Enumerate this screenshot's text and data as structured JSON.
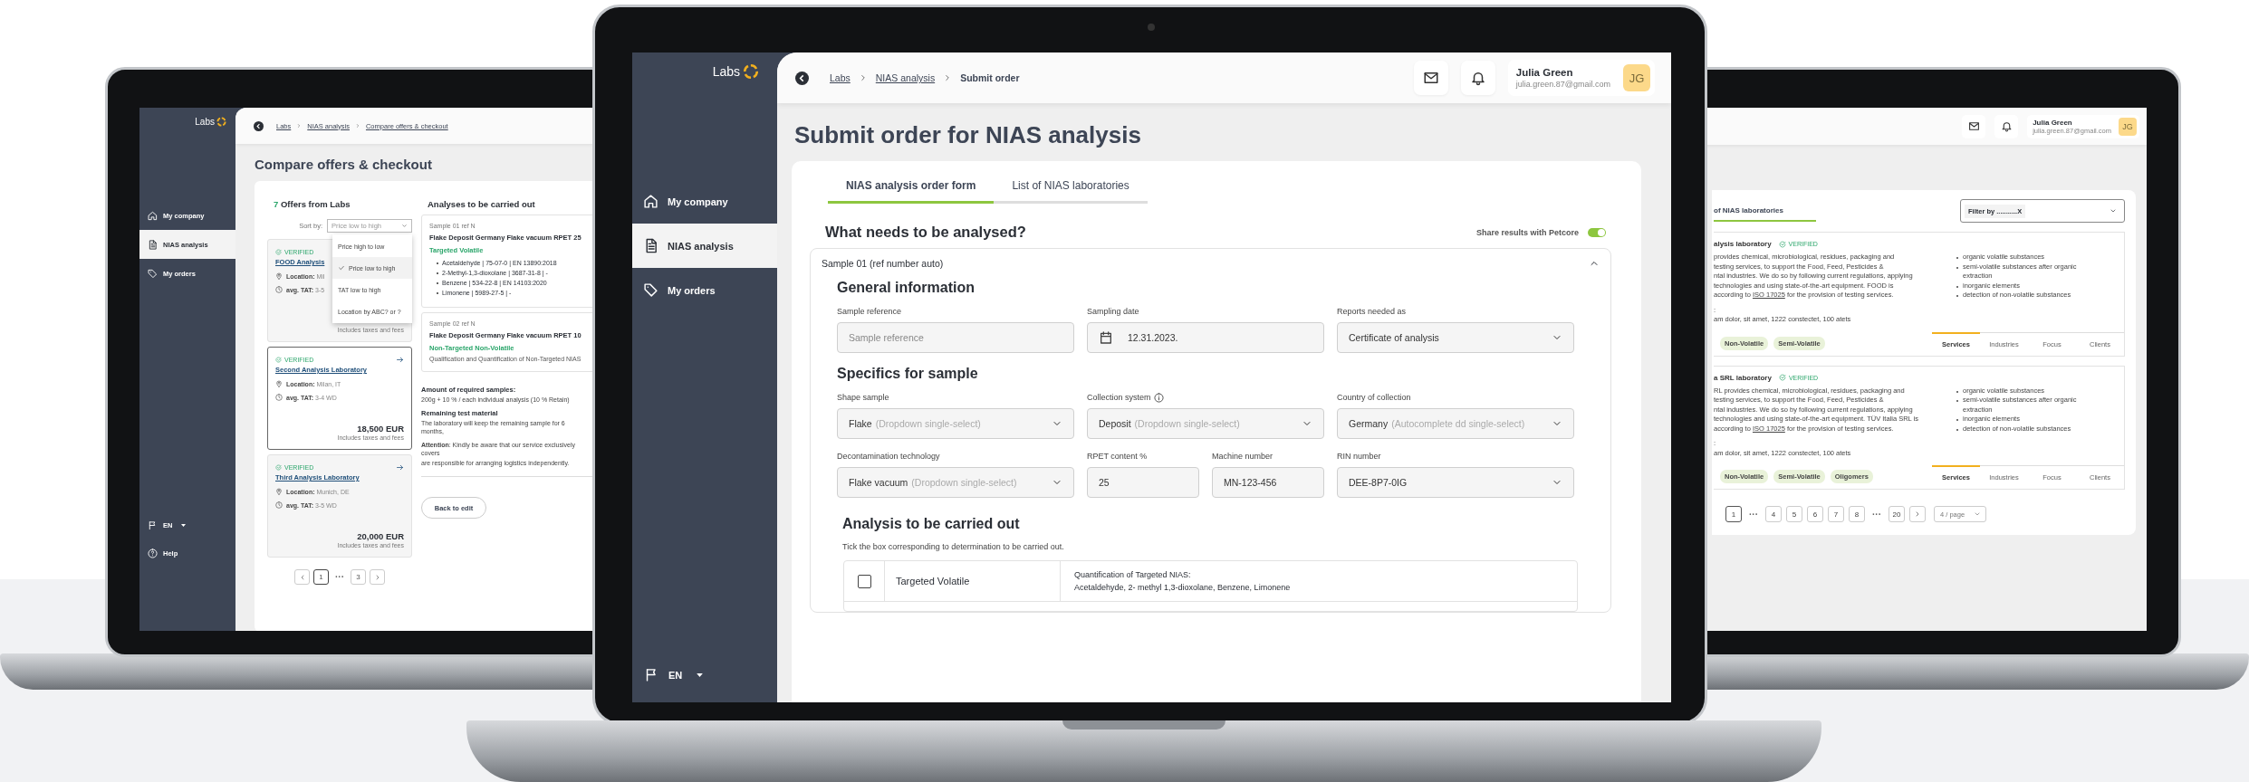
{
  "left_screen": {
    "sidebar": {
      "logo": "Labs",
      "items": [
        {
          "kind": "home",
          "label": "My company",
          "selected": false
        },
        {
          "kind": "document",
          "label": "NIAS analysis",
          "selected": true
        },
        {
          "kind": "tag",
          "label": "My orders",
          "selected": false
        }
      ],
      "language": "EN",
      "help": "Help"
    },
    "breadcrumb": [
      {
        "label": "Labs"
      },
      {
        "label": "NIAS analysis"
      },
      {
        "label": "Compare offers & checkout"
      }
    ],
    "title": "Compare offers & checkout",
    "offers": {
      "count": "7",
      "label": "Offers from Labs",
      "sort_label": "Sort by:",
      "sort_value": "Price low to high",
      "sort_open": true,
      "sort_options": [
        {
          "label": "Price high to low",
          "selected": false
        },
        {
          "label": "Price low to high",
          "selected": true
        },
        {
          "label": "TAT low to high",
          "selected": false
        },
        {
          "label": "Location by ABC? or ?",
          "selected": false
        }
      ],
      "cards": [
        {
          "verified": "VERIFIED",
          "name": "FOOD Analysis",
          "location_label": "Location:",
          "location": "Mil",
          "tat_label": "avg. TAT:",
          "tat": "3-5",
          "note": "Includes taxes and fees",
          "arrow": false,
          "selected": false
        },
        {
          "verified": "VERIFIED",
          "name": "Second Analysis Laboratory",
          "location_label": "Location:",
          "location": "Milan, IT",
          "tat_label": "avg. TAT:",
          "tat": "3-4 WD",
          "price": "18,500 EUR",
          "note": "Includes taxes and fees",
          "arrow": true,
          "selected": true
        },
        {
          "verified": "VERIFIED",
          "name": "Third Analysis Laboratory",
          "location_label": "Location:",
          "location": "Munich, DE",
          "tat_label": "avg. TAT:",
          "tat": "3-5 WD",
          "price": "20,000 EUR",
          "note": "Includes taxes and fees",
          "arrow": true,
          "selected": false
        }
      ],
      "pagination": [
        {
          "kind": "prev"
        },
        {
          "kind": "page",
          "label": "1",
          "selected": true
        },
        {
          "kind": "ellipsis",
          "label": "···"
        },
        {
          "kind": "page",
          "label": "3",
          "selected": false
        },
        {
          "kind": "next"
        }
      ]
    },
    "analyses": {
      "title": "Analyses to be carried out",
      "samples": [
        {
          "ref": "Sample 01 ref N",
          "title": "Flake Deposit Germany Flake vacuum RPET 25",
          "analysis": "Targeted Volatile",
          "items": [
            "Acetaldehyde  |  75-07-0  |  EN 13890:2018",
            "2-Methyl-1,3-dioxolane  |  3687-31-8  |  -",
            "Benzene  |  534-22-8  |  EN 14103:2020",
            "Limonene  |  5989-27-5  |  -"
          ]
        },
        {
          "ref": "Sample 02 ref N",
          "title": "Flake Deposit Germany Flake vacuum RPET 10",
          "analysis": "Non-Targeted Non-Volatile",
          "note": "Qualification and Quantification of Non-Targeted NIAS"
        }
      ],
      "amount_title": "Amount of required samples:",
      "amount_text": "200g  + 10 % / each individual analysis (10 % Retain)",
      "remaining_title": "Remaining test material",
      "remaining_text": "The laboratory will keep the remaining sample for 6 months,",
      "attention_lines": [
        "**Attention**: Kindly be aware that our service exclusively covers",
        "are responsible for arranging logistics independently."
      ],
      "back_button": "Back to edit"
    }
  },
  "center_screen": {
    "sidebar": {
      "logo": "Labs",
      "items": [
        {
          "kind": "home",
          "label": "My company",
          "selected": false
        },
        {
          "kind": "document",
          "label": "NIAS analysis",
          "selected": true
        },
        {
          "kind": "tag",
          "label": "My orders",
          "selected": false
        }
      ],
      "language": "EN"
    },
    "breadcrumb": [
      {
        "label": "Labs",
        "kind": "link"
      },
      {
        "label": "NIAS analysis",
        "kind": "link"
      },
      {
        "label": "Submit order",
        "kind": "current"
      }
    ],
    "user": {
      "name": "Julia Green",
      "email": "julia.green.87@gmail.com",
      "initials": "JG"
    },
    "title": "Submit order for NIAS analysis",
    "tabs": [
      {
        "label": "NIAS analysis order form",
        "selected": true
      },
      {
        "label": "List of NIAS laboratories",
        "selected": false
      }
    ],
    "section_title": "What needs to be analysed?",
    "share_toggle": {
      "label": "Share results with Petcore",
      "on": true
    },
    "sample": {
      "title": "Sample 01 (ref number auto)",
      "expanded": true,
      "groups": [
        {
          "title": "General information",
          "rows": [
            [
              {
                "kind": "text",
                "label": "Sample reference",
                "placeholder": "Sample reference"
              },
              {
                "kind": "date",
                "label": "Sampling date",
                "value": "12.31.2023."
              },
              {
                "kind": "select",
                "label": "Reports needed as",
                "value": "Certificate of analysis"
              }
            ]
          ]
        },
        {
          "title": "Specifics for sample",
          "rows": [
            [
              {
                "kind": "select",
                "label": "Shape sample",
                "value": "Flake",
                "hint": "(Dropdown single-select)"
              },
              {
                "kind": "select",
                "label": "Collection system",
                "info": true,
                "value": "Deposit",
                "hint": "(Dropdown single-select)"
              },
              {
                "kind": "select",
                "label": "Country of collection",
                "value": "Germany",
                "hint": "(Autocomplete dd single-select)"
              }
            ],
            [
              {
                "kind": "select",
                "label": "Decontamination technology",
                "value": "Flake vacuum",
                "hint": "(Dropdown single-select)"
              },
              {
                "kind": "pair",
                "fields": [
                  {
                    "kind": "text",
                    "label": "RPET content %",
                    "value": "25"
                  },
                  {
                    "kind": "text",
                    "label": "Machine number",
                    "value": "MN-123-456"
                  }
                ]
              },
              {
                "kind": "select",
                "label": "RIN number",
                "value": "DEE-8P7-0IG"
              }
            ]
          ]
        }
      ]
    },
    "analysis": {
      "title": "Analysis to be carried out",
      "hint": "Tick the box corresponding to determination to be carried out.",
      "rows": [
        {
          "checked": false,
          "name": "Targeted Volatile",
          "description_title": "Quantification of Targeted NIAS:",
          "description": "Acetaldehyde,  2- methyl 1,3-dioxolane,  Benzene,  Limonene"
        }
      ]
    }
  },
  "right_screen": {
    "user": {
      "name": "Julia Green",
      "email": "julia.green.87@gmail.com",
      "initials": "JG"
    },
    "tab_label": "of NIAS laboratories",
    "filter_chip": "Filter by ...........X",
    "labs": [
      {
        "name": "alysis laboratory",
        "verified": "VERIFIED",
        "lines": [
          "provides chemical, microbiological, residues, packaging and",
          "testing services, to support the Food, Feed, Pesticides &",
          "ntal industries. We do so by following current regulations, applying",
          "technologies and using state-of-the-art equipment. FOOD is"
        ],
        "iso": {
          "prefix": "according to",
          "link": "ISO 17025",
          "suffix": "for the provision of testing services."
        },
        "contact_label": ":",
        "contact": "am dolor, sit amet, 1222 constectet, 100 atets",
        "bullets": [
          "organic volatile substances",
          "semi-volatile substances after organic extraction",
          "inorganic elements",
          "detection of non-volatile substances"
        ],
        "tags": [
          "Non-Volatile",
          "Semi-Volatile"
        ],
        "tabs": [
          {
            "label": "Services",
            "selected": true
          },
          {
            "label": "Industries",
            "selected": false
          },
          {
            "label": "Focus",
            "selected": false
          },
          {
            "label": "Clients",
            "selected": false
          }
        ]
      },
      {
        "name": "a SRL laboratory",
        "verified": "VERIFIED",
        "lines": [
          "RL provides chemical, microbiological, residues, packaging and",
          "testing services, to support the Food, Feed, Pesticides &",
          "ntal industries. We do so by following current regulations, applying",
          "technologies and using state-of-the-art equipment. TÜV Italia SRL is"
        ],
        "iso": {
          "prefix": "according to",
          "link": "ISO 17025",
          "suffix": "for the provision of testing services."
        },
        "contact_label": ":",
        "contact": "am dolor, sit amet, 1222 constectet, 100 atets",
        "bullets": [
          "organic volatile substances",
          "semi-volatile substances after organic extraction",
          "inorganic elements",
          "detection of non-volatile substances"
        ],
        "tags": [
          "Non-Volatile",
          "Semi-Volatile",
          "Oligomers"
        ],
        "tabs": [
          {
            "label": "Services",
            "selected": true
          },
          {
            "label": "Industries",
            "selected": false
          },
          {
            "label": "Focus",
            "selected": false
          },
          {
            "label": "Clients",
            "selected": false
          }
        ]
      }
    ],
    "pagination": [
      {
        "kind": "page",
        "label": "1",
        "selected": true
      },
      {
        "kind": "ellipsis",
        "label": "···"
      },
      {
        "kind": "page",
        "label": "4",
        "selected": false
      },
      {
        "kind": "page",
        "label": "5",
        "selected": false
      },
      {
        "kind": "page",
        "label": "6",
        "selected": false
      },
      {
        "kind": "page",
        "label": "7",
        "selected": false
      },
      {
        "kind": "page",
        "label": "8",
        "selected": false
      },
      {
        "kind": "ellipsis",
        "label": "···"
      },
      {
        "kind": "page",
        "label": "20",
        "selected": false
      },
      {
        "kind": "next"
      }
    ],
    "per_page": "4 / page"
  }
}
